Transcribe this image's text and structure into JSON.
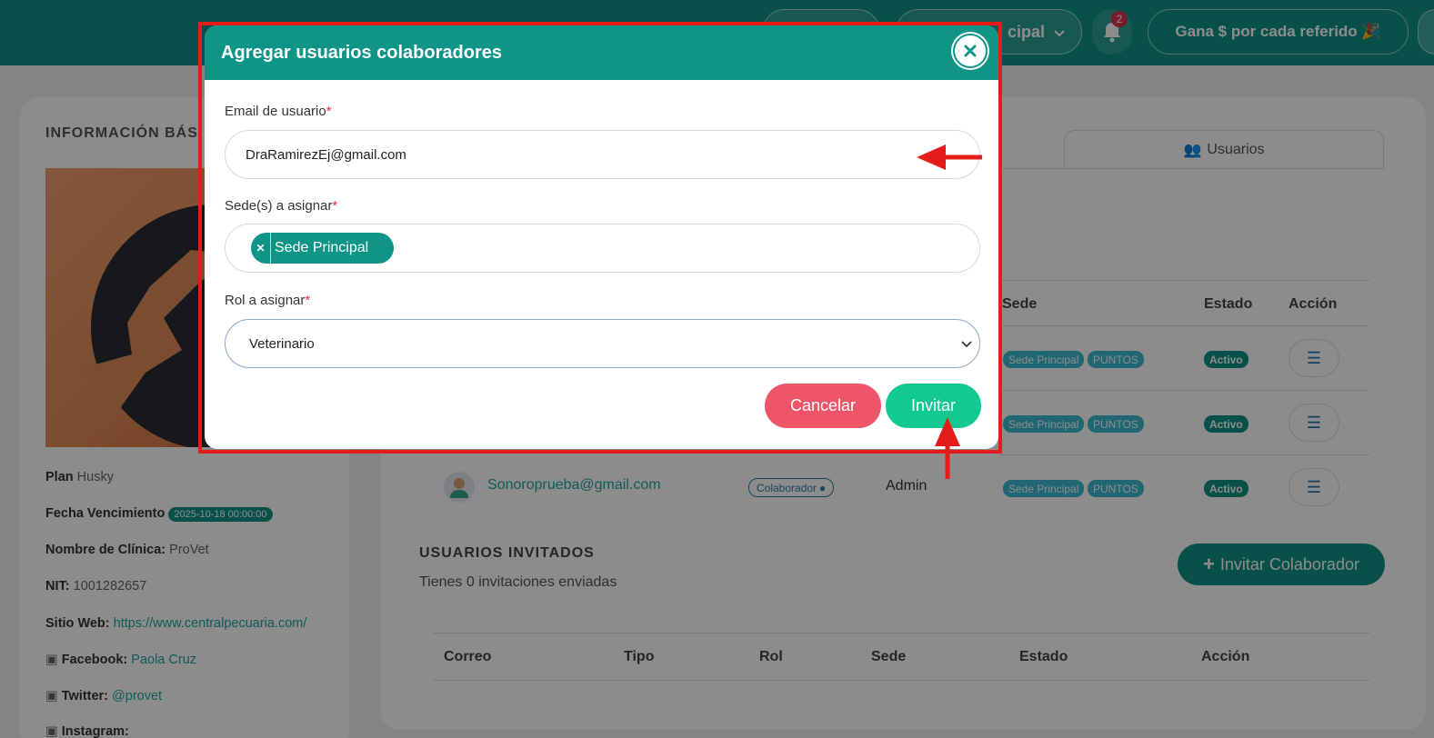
{
  "topbar": {
    "sede_label": "cipal",
    "notification_count": "2",
    "referral_label": "Gana $ por cada referido 🎉"
  },
  "left_panel": {
    "title": "INFORMACIÓN BÁS",
    "plan_label": "Plan",
    "plan_value": "Husky",
    "expiry_label": "Fecha Vencimiento",
    "expiry_value": "2025-10-18 00:00:00",
    "clinic_label": "Nombre de Clínica:",
    "clinic_value": "ProVet",
    "nit_label": "NIT:",
    "nit_value": "1001282657",
    "website_label": "Sitio Web:",
    "website_value": "https://www.centralpecuaria.com/",
    "facebook_label": "Facebook:",
    "facebook_value": "Paola Cruz",
    "twitter_label": "Twitter:",
    "twitter_value": "@provet",
    "instagram_label": "Instagram:"
  },
  "main": {
    "tab_users": "Usuarios",
    "table_headers": {
      "sede": "Sede",
      "estado": "Estado",
      "accion": "Acción"
    },
    "rows": [
      {
        "sede": "Sede Principal",
        "puntos": "PUNTOS",
        "estado": "Activo"
      },
      {
        "sede": "Sede Principal",
        "puntos": "PUNTOS",
        "estado": "Activo"
      },
      {
        "email": "Sonoroprueba@gmail.com",
        "tipo": "Colaborador",
        "rol": "Admin",
        "sede": "Sede Principal",
        "puntos": "PUNTOS",
        "estado": "Activo"
      }
    ],
    "invited_title": "USUARIOS INVITADOS",
    "invited_subtitle": "Tienes 0 invitaciones enviadas",
    "invite_button": "Invitar Colaborador",
    "invited_headers": {
      "correo": "Correo",
      "tipo": "Tipo",
      "rol": "Rol",
      "sede": "Sede",
      "estado": "Estado",
      "accion": "Acción"
    }
  },
  "modal": {
    "title": "Agregar usuarios colaboradores",
    "email_label": "Email de usuario",
    "email_value": "DraRamirezEj@gmail.com",
    "sede_label": "Sede(s) a asignar",
    "sede_tag": "Sede Principal",
    "role_label": "Rol a asignar",
    "role_value": "Veterinario",
    "required_mark": "*",
    "cancel_button": "Cancelar",
    "invite_button": "Invitar"
  },
  "colors": {
    "brand_teal": "#0f9488",
    "invite_green": "#12c98f",
    "cancel_red": "#ee5569",
    "annotation_red": "#e31b1b"
  }
}
